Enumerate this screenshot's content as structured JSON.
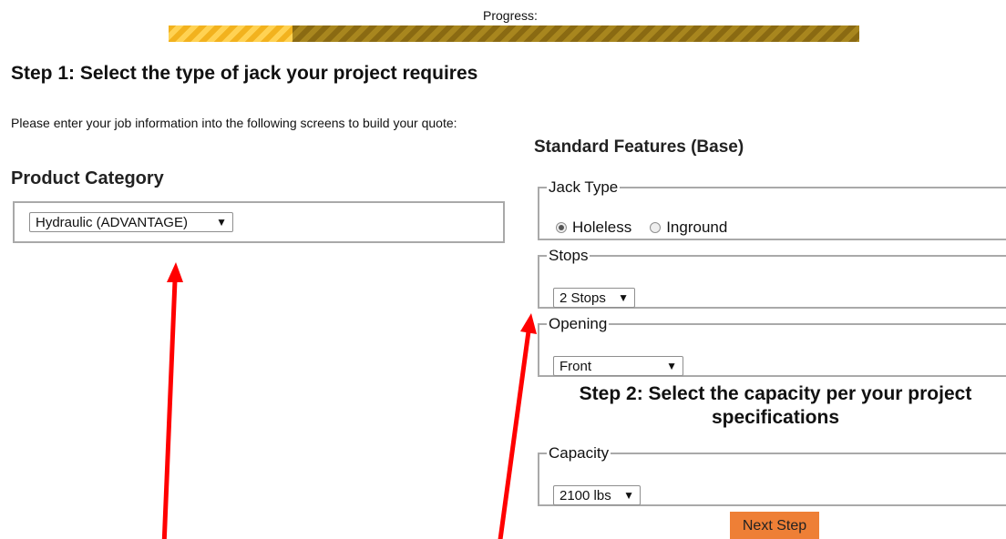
{
  "progress": {
    "label": "Progress:",
    "fraction": 0.18
  },
  "step1": {
    "title": "Step 1: Select the type of jack your project requires",
    "intro": "Please enter your job information into the following screens to build your quote:"
  },
  "product_category": {
    "heading": "Product Category",
    "selected": "Hydraulic (ADVANTAGE)"
  },
  "standard_features": {
    "heading": "Standard Features (Base)",
    "jack_type": {
      "legend": "Jack Type",
      "options": [
        {
          "label": "Holeless",
          "checked": true
        },
        {
          "label": "Inground",
          "checked": false
        }
      ]
    },
    "stops": {
      "legend": "Stops",
      "selected": "2 Stops"
    },
    "opening": {
      "legend": "Opening",
      "selected": "Front"
    }
  },
  "step2": {
    "title": "Step 2: Select the capacity per your project specifications",
    "capacity": {
      "legend": "Capacity",
      "selected": "2100 lbs"
    }
  },
  "next_button": {
    "label": "Next Step"
  },
  "colors": {
    "progress_fill": "#f2b21e",
    "progress_track": "#8a6a12",
    "button": "#ee7f36",
    "annotation_arrow": "#ff0000"
  },
  "icons": {
    "select_caret": "caret-down-icon"
  }
}
